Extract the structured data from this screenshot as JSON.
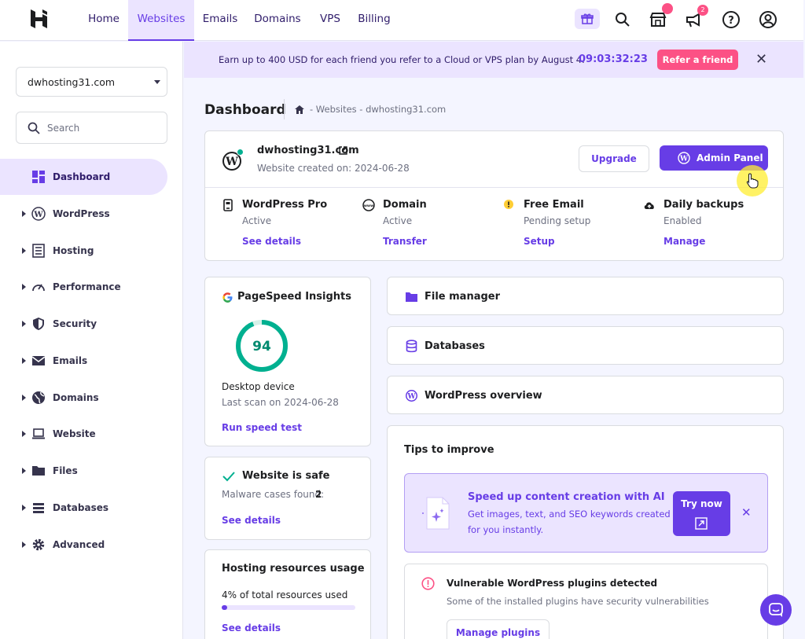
{
  "nav": {
    "items": [
      "Home",
      "Websites",
      "Emails",
      "Domains",
      "VPS",
      "Billing"
    ],
    "active": "Websites",
    "notification_count": "2"
  },
  "sidebar": {
    "site": "dwhosting31.com",
    "search_placeholder": "Search",
    "items": [
      {
        "label": "Dashboard",
        "icon": "dashboard-icon"
      },
      {
        "label": "WordPress",
        "icon": "wordpress-icon"
      },
      {
        "label": "Hosting",
        "icon": "hosting-icon"
      },
      {
        "label": "Performance",
        "icon": "performance-icon"
      },
      {
        "label": "Security",
        "icon": "shield-icon"
      },
      {
        "label": "Emails",
        "icon": "mail-icon"
      },
      {
        "label": "Domains",
        "icon": "globe-icon"
      },
      {
        "label": "Website",
        "icon": "laptop-icon"
      },
      {
        "label": "Files",
        "icon": "folder-icon"
      },
      {
        "label": "Databases",
        "icon": "database-icon"
      },
      {
        "label": "Advanced",
        "icon": "gear-icon"
      }
    ]
  },
  "banner": {
    "text": "Earn up to 400 USD for each friend you refer to a Cloud or VPS plan by August 4.",
    "timer": "09:03:32:23",
    "button": "Refer a friend"
  },
  "page": {
    "title": "Dashboard",
    "breadcrumb": "- Websites - dwhosting31.com"
  },
  "site": {
    "name": "dwhosting31.com",
    "created": "Website created on: 2024-06-28",
    "upgrade": "Upgrade",
    "admin_panel": "Admin Panel",
    "features": [
      {
        "title": "WordPress Pro",
        "status": "Active",
        "link": "See details",
        "icon": "phone-icon"
      },
      {
        "title": "Domain",
        "status": "Active",
        "link": "Transfer",
        "icon": "www-icon"
      },
      {
        "title": "Free Email",
        "status": "Pending setup",
        "link": "Setup",
        "icon": "warning-dot-icon"
      },
      {
        "title": "Daily backups",
        "status": "Enabled",
        "link": "Manage",
        "icon": "cloud-upload-icon"
      }
    ]
  },
  "pagespeed": {
    "title": "PageSpeed Insights",
    "score": "94",
    "score_fraction": 0.94,
    "device": "Desktop device",
    "last_scan": "Last scan on 2024-06-28",
    "action": "Run speed test"
  },
  "security": {
    "title": "Website is safe",
    "malware_label": "Malware cases found:",
    "malware_count": "2",
    "link": "See details"
  },
  "resources": {
    "title": "Hosting resources usage",
    "usage": "4% of total resources used",
    "usage_fraction": 0.04,
    "link": "See details"
  },
  "tools": [
    {
      "label": "File manager",
      "icon": "folder-icon"
    },
    {
      "label": "Databases",
      "icon": "database-icon"
    },
    {
      "label": "WordPress overview",
      "icon": "wordpress-icon"
    }
  ],
  "tips": {
    "title": "Tips to improve",
    "ai": {
      "title": "Speed up content creation with AI",
      "desc_line1": "Get images, text, and SEO keywords created",
      "desc_line2": "for you instantly.",
      "button": "Try now"
    },
    "vuln": {
      "title": "Vulnerable WordPress plugins detected",
      "desc": "Some of the installed plugins have security vulnerabilities",
      "button": "Manage plugins"
    }
  },
  "colors": {
    "accent": "#673de6",
    "accent_light": "#ebe4ff",
    "pink": "#fc5185",
    "green": "#00b090"
  }
}
